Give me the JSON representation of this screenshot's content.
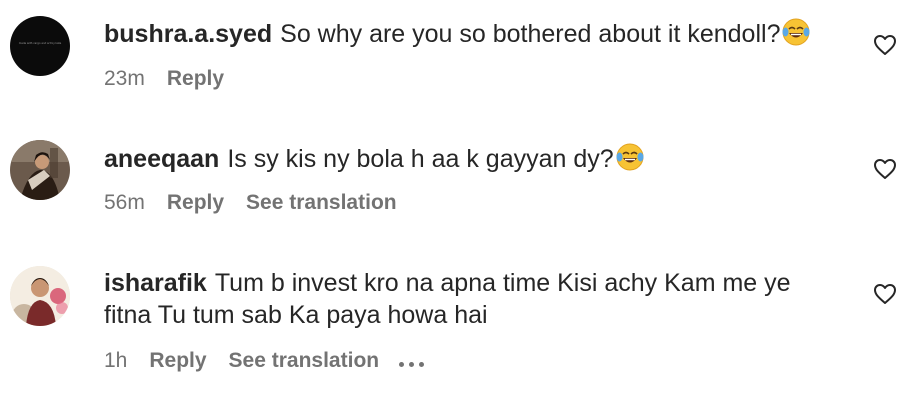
{
  "comments": [
    {
      "username": "bushra.a.syed",
      "text": "So why are you so bothered about it kendoll?",
      "emoji": "face-with-tears-of-joy",
      "time": "23m",
      "reply_label": "Reply",
      "avatar_fine_print": "made with cargo and art by kate"
    },
    {
      "username": "aneeqaan",
      "text": "Is sy kis ny bola h aa k gayyan dy?",
      "emoji": "face-with-tears-of-joy",
      "time": "56m",
      "reply_label": "Reply",
      "translation_label": "See translation"
    },
    {
      "username": "isharafik",
      "text": "Tum b invest kro na apna time Kisi achy Kam me ye fitna Tu tum sab Ka paya howa hai",
      "time": "1h",
      "reply_label": "Reply",
      "translation_label": "See translation",
      "more_icon": "ellipsis-icon"
    }
  ],
  "icons": {
    "like": "heart-outline-icon"
  },
  "colors": {
    "text": "#262626",
    "secondary_text": "#737373",
    "background": "#ffffff"
  }
}
